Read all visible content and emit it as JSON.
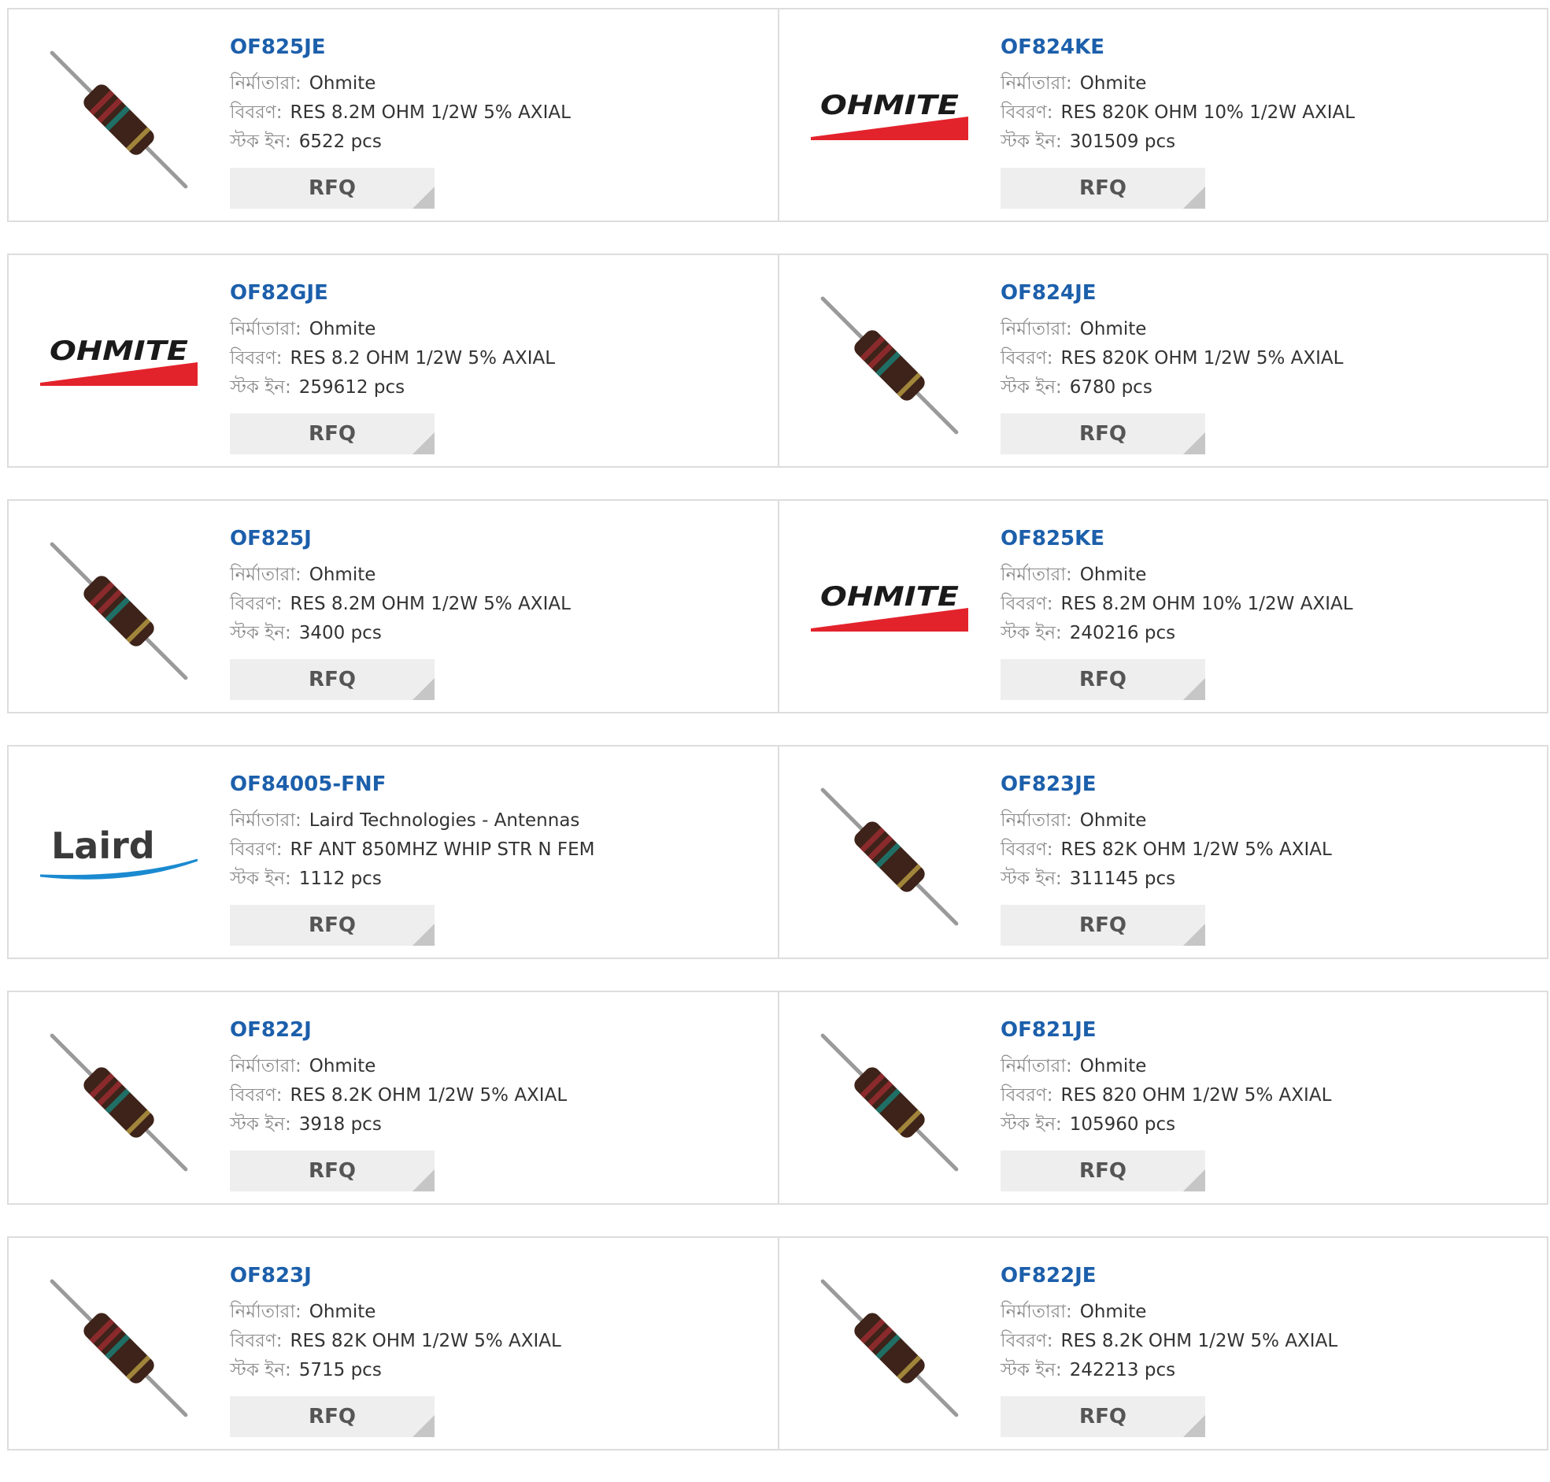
{
  "labels": {
    "manufacturer": "নির্মাতারা:",
    "description": "বিবরণ:",
    "stock": "স্টক ইন:",
    "rfq": "RFQ"
  },
  "colors": {
    "part_number": "#1c5fab",
    "card_border": "#dddddd",
    "rfq_bg": "#eeeeee",
    "ohmite_red": "#e3232c"
  },
  "products": [
    {
      "part": "OF825JE",
      "manufacturer": "Ohmite",
      "description": "RES 8.2M OHM 1/2W 5% AXIAL",
      "stock": "6522 pcs",
      "image": "resistor-icon"
    },
    {
      "part": "OF824KE",
      "manufacturer": "Ohmite",
      "description": "RES 820K OHM 10% 1/2W AXIAL",
      "stock": "301509 pcs",
      "image": "ohmite-logo",
      "logo_text": "OHMITE"
    },
    {
      "part": "OF82GJE",
      "manufacturer": "Ohmite",
      "description": "RES 8.2 OHM 1/2W 5% AXIAL",
      "stock": "259612 pcs",
      "image": "ohmite-logo",
      "logo_text": "OHMITE"
    },
    {
      "part": "OF824JE",
      "manufacturer": "Ohmite",
      "description": "RES 820K OHM 1/2W 5% AXIAL",
      "stock": "6780 pcs",
      "image": "resistor-icon"
    },
    {
      "part": "OF825J",
      "manufacturer": "Ohmite",
      "description": "RES 8.2M OHM 1/2W 5% AXIAL",
      "stock": "3400 pcs",
      "image": "resistor-icon"
    },
    {
      "part": "OF825KE",
      "manufacturer": "Ohmite",
      "description": "RES 8.2M OHM 10% 1/2W AXIAL",
      "stock": "240216 pcs",
      "image": "ohmite-logo",
      "logo_text": "OHMITE"
    },
    {
      "part": "OF84005-FNF",
      "manufacturer": "Laird Technologies - Antennas",
      "description": "RF ANT 850MHZ WHIP STR N FEM",
      "stock": "1112 pcs",
      "image": "laird-logo",
      "logo_text": "Laird"
    },
    {
      "part": "OF823JE",
      "manufacturer": "Ohmite",
      "description": "RES 82K OHM 1/2W 5% AXIAL",
      "stock": "311145 pcs",
      "image": "resistor-icon"
    },
    {
      "part": "OF822J",
      "manufacturer": "Ohmite",
      "description": "RES 8.2K OHM 1/2W 5% AXIAL",
      "stock": "3918 pcs",
      "image": "resistor-icon"
    },
    {
      "part": "OF821JE",
      "manufacturer": "Ohmite",
      "description": "RES 820 OHM 1/2W 5% AXIAL",
      "stock": "105960 pcs",
      "image": "resistor-icon"
    },
    {
      "part": "OF823J",
      "manufacturer": "Ohmite",
      "description": "RES 82K OHM 1/2W 5% AXIAL",
      "stock": "5715 pcs",
      "image": "resistor-icon"
    },
    {
      "part": "OF822JE",
      "manufacturer": "Ohmite",
      "description": "RES 8.2K OHM 1/2W 5% AXIAL",
      "stock": "242213 pcs",
      "image": "resistor-icon"
    }
  ]
}
